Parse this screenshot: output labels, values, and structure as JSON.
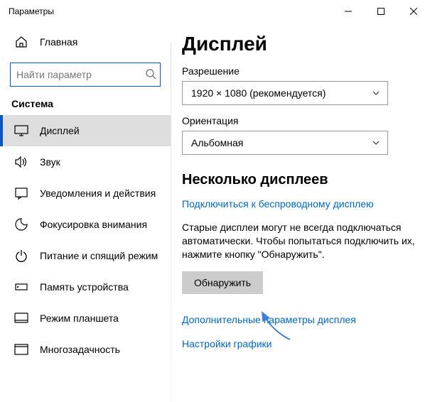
{
  "window": {
    "title": "Параметры"
  },
  "sidebar": {
    "home": "Главная",
    "search_placeholder": "Найти параметр",
    "section": "Система",
    "items": [
      {
        "label": "Дисплей"
      },
      {
        "label": "Звук"
      },
      {
        "label": "Уведомления и действия"
      },
      {
        "label": "Фокусировка внимания"
      },
      {
        "label": "Питание и спящий режим"
      },
      {
        "label": "Память устройства"
      },
      {
        "label": "Режим планшета"
      },
      {
        "label": "Многозадачность"
      }
    ]
  },
  "main": {
    "title": "Дисплей",
    "resolution_label": "Разрешение",
    "resolution_value": "1920 × 1080 (рекомендуется)",
    "orientation_label": "Ориентация",
    "orientation_value": "Альбомная",
    "multi_h": "Несколько дисплеев",
    "connect_link": "Подключиться к беспроводному дисплею",
    "detect_desc": "Старые дисплеи могут не всегда подключаться автоматически. Чтобы попытаться подключить их, нажмите кнопку \"Обнаружить\".",
    "detect_btn": "Обнаружить",
    "more_link": "Дополнительные параметры дисплея",
    "gfx_link": "Настройки графики"
  }
}
